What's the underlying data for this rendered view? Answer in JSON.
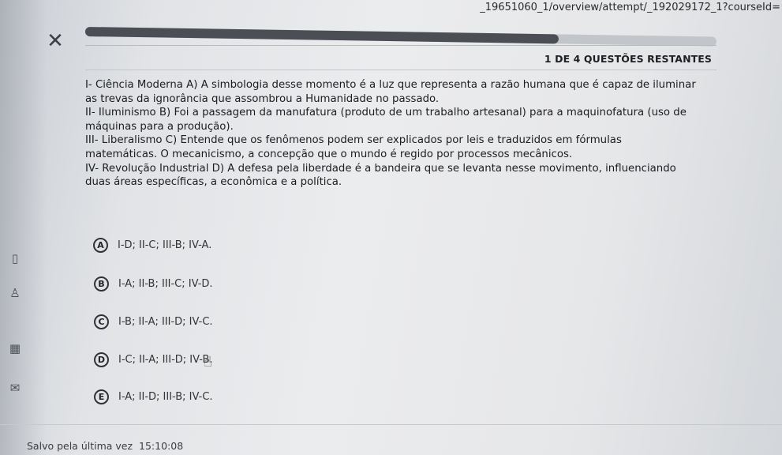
{
  "browser": {
    "url_fragment": "_19651060_1/overview/attempt/_192029172_1?courseId="
  },
  "quiz": {
    "progress_fraction": 0.75,
    "remaining_number": "1",
    "remaining_label": "DE 4 QUESTÕES RESTANTES",
    "question_lines": [
      "I- Ciência Moderna A) A simbologia desse momento é a luz que representa a razão humana que é capaz de iluminar as trevas da ignorância que assombrou a Humanidade no passado.",
      "II- Iluminismo B) Foi a passagem da manufatura (produto de um trabalho artesanal) para a maquinofatura (uso de máquinas para a produção).",
      "III- Liberalismo C) Entende que os fenômenos podem ser explicados por leis e traduzidos em fórmulas matemáticas. O mecanicismo, a concepção que o mundo é regido por processos mecânicos.",
      "IV- Revolução Industrial D) A defesa pela liberdade é a bandeira que se levanta nesse movimento, influenciando duas áreas específicas, a econômica e a política."
    ],
    "options": [
      {
        "letter": "A",
        "text": "I-D; II-C; III-B; IV-A."
      },
      {
        "letter": "B",
        "text": "I-A; II-B; III-C; IV-D."
      },
      {
        "letter": "C",
        "text": "I-B; II-A; III-D; IV-C."
      },
      {
        "letter": "D",
        "text": "I-C; II-A; III-D; IV-B."
      },
      {
        "letter": "E",
        "text": "I-A; II-D; III-B; IV-C."
      }
    ],
    "saved_label": "Salvo pela última vez",
    "saved_time": "15:10:08"
  },
  "icons": {
    "close": "close-icon",
    "cursor": "hand-pointer-icon"
  }
}
